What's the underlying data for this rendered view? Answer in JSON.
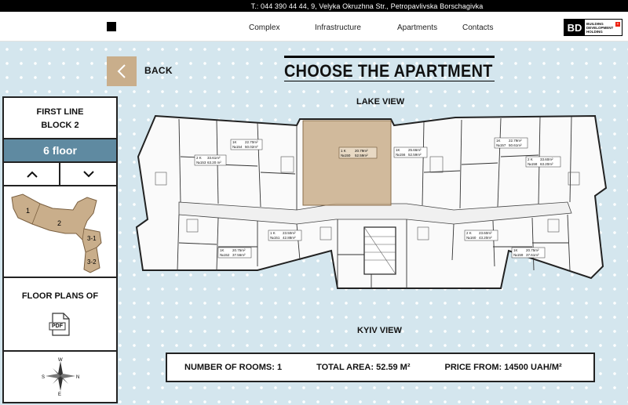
{
  "topbar": {
    "contact": "T.: 044 390 44 44, 9, Velyka Okruzhna Str., Petropavlivska Borschagivka"
  },
  "nav": {
    "items": [
      "Complex",
      "Infrastructure",
      "Apartments",
      "Contacts"
    ]
  },
  "logo": {
    "mark": "BD",
    "line1": "BUILDING",
    "line2": "DEVELOPMENT",
    "line3": "HOLDING",
    "flag": "+"
  },
  "back": {
    "label": "BACK"
  },
  "title": "CHOOSE THE APARTMENT",
  "views": {
    "top": "LAKE VIEW",
    "bottom": "KYIV VIEW"
  },
  "sidebar": {
    "line1": "FIRST LINE",
    "line2": "BLOCK 2",
    "floor": "6 floor",
    "up_arrow": "chevron-up-icon",
    "down_arrow": "chevron-down-icon",
    "sections": [
      "1",
      "2",
      "3-1",
      "3-2"
    ],
    "floor_plans_label": "FLOOR PLANS OF",
    "pdf_label": "PDF",
    "compass": {
      "n": "N",
      "s": "S",
      "w": "W",
      "e": "E"
    }
  },
  "plan": {
    "selected_apartment": {
      "rooms": "1 K",
      "area": "20.79m²",
      "number": "№150",
      "total": "52.59m²"
    },
    "labels": {
      "apt154": {
        "rooms": "1K",
        "area": "22.70m²",
        "num": "№154",
        "total": "50.02m²"
      },
      "apt153": {
        "rooms": "2 K",
        "area": "33.61m²",
        "num": "№153",
        "total": "63.20 m²"
      },
      "apt156": {
        "rooms": "1K",
        "area": "25.66m²",
        "num": "№156",
        "total": "52.59m²"
      },
      "apt157": {
        "rooms": "1K",
        "area": "22.79m²",
        "num": "№157",
        "total": "50.61m²"
      },
      "apt158": {
        "rooms": "2 K",
        "area": "33.60m²",
        "num": "№158",
        "total": "63.20m²"
      },
      "apt151": {
        "rooms": "1 K",
        "area": "23.50m²",
        "num": "№151",
        "total": "42.88m²"
      },
      "apt160": {
        "rooms": "2 K",
        "area": "23.60m²",
        "num": "№160",
        "total": "43.20m²"
      },
      "apt152": {
        "rooms": "1K",
        "area": "20.75m²",
        "num": "№152",
        "total": "37.56m²"
      },
      "apt159": {
        "rooms": "1K",
        "area": "20.75m²",
        "num": "№159",
        "total": "37.61m²"
      }
    }
  },
  "info": {
    "rooms_label": "NUMBER OF ROOMS:",
    "rooms_value": "1",
    "area_label": "TOTAL AREA:",
    "area_value": "52.59 M²",
    "price_label": "PRICE FROM:",
    "price_value": "14500 UAH/M²"
  },
  "colors": {
    "background": "#d4e6ee",
    "accent": "#c9ae8b",
    "floor_bar": "#5f8aa1",
    "selected": "#c9ae8b"
  }
}
